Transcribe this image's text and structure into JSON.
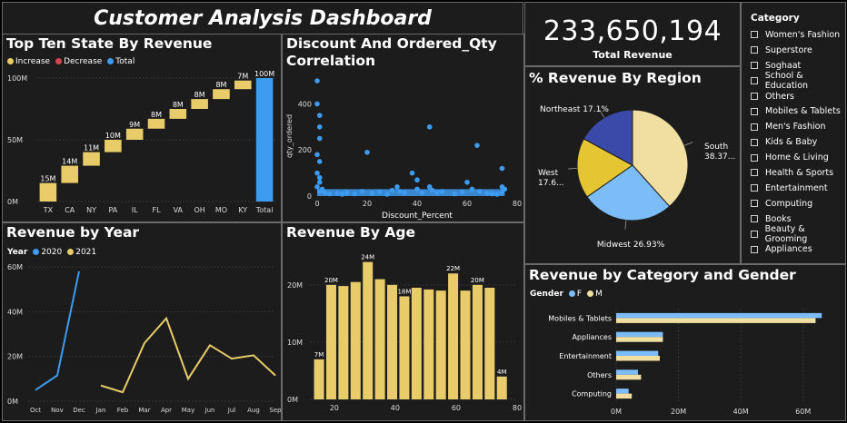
{
  "dashboard": {
    "title": "Customer Analysis Dashboard"
  },
  "colors": {
    "yellow": "#e8cc6a",
    "blue": "#3d9bf0",
    "navy": "#3b4aa8",
    "light_blue": "#7cbcf7",
    "sand": "#f0dfa0",
    "gold": "#e5c532",
    "decrease_red": "#d0494f"
  },
  "kpi": {
    "value": "233,650,194",
    "label": "Total Revenue"
  },
  "top_states": {
    "title": "Top Ten State By Revenue",
    "legend": [
      {
        "label": "Increase",
        "color": "#e8cc6a"
      },
      {
        "label": "Decrease",
        "color": "#d0494f"
      },
      {
        "label": "Total",
        "color": "#3d9bf0"
      }
    ],
    "y_ticks": [
      "100M",
      "50M",
      "0M"
    ],
    "chart_data": {
      "type": "bar",
      "subtype": "waterfall",
      "categories": [
        "TX",
        "CA",
        "NY",
        "PA",
        "IL",
        "FL",
        "VA",
        "OH",
        "MO",
        "KY",
        "Total"
      ],
      "values": [
        15,
        14,
        11,
        10,
        9,
        8,
        8,
        8,
        8,
        7,
        100
      ],
      "labels": [
        "15M",
        "14M",
        "11M",
        "10M",
        "9M",
        "8M",
        "8M",
        "8M",
        "8M",
        "7M",
        "100M"
      ],
      "ylim": [
        0,
        100
      ]
    }
  },
  "discount": {
    "title": "Discount And Ordered_Qty\nCorrelation",
    "xlabel": "Discount_Percent",
    "ylabel": "qty_ordered",
    "y_ticks": [
      "400",
      "200",
      "0"
    ],
    "x_ticks": [
      "0",
      "20",
      "40",
      "60",
      "80"
    ],
    "chart_data": {
      "type": "scatter",
      "xlim": [
        0,
        80
      ],
      "ylim": [
        0,
        520
      ],
      "points": [
        [
          0,
          500
        ],
        [
          0,
          400
        ],
        [
          1,
          350
        ],
        [
          1,
          300
        ],
        [
          1,
          250
        ],
        [
          0,
          180
        ],
        [
          1,
          150
        ],
        [
          0,
          100
        ],
        [
          1,
          80
        ],
        [
          1,
          60
        ],
        [
          0,
          40
        ],
        [
          2,
          30
        ],
        [
          1,
          20
        ],
        [
          3,
          15
        ],
        [
          5,
          10
        ],
        [
          8,
          12
        ],
        [
          10,
          8
        ],
        [
          12,
          15
        ],
        [
          15,
          10
        ],
        [
          18,
          20
        ],
        [
          20,
          190
        ],
        [
          22,
          12
        ],
        [
          25,
          18
        ],
        [
          28,
          8
        ],
        [
          30,
          25
        ],
        [
          32,
          40
        ],
        [
          33,
          20
        ],
        [
          35,
          15
        ],
        [
          38,
          100
        ],
        [
          40,
          70
        ],
        [
          40,
          30
        ],
        [
          42,
          15
        ],
        [
          45,
          300
        ],
        [
          45,
          40
        ],
        [
          46,
          25
        ],
        [
          48,
          15
        ],
        [
          50,
          20
        ],
        [
          55,
          10
        ],
        [
          58,
          18
        ],
        [
          60,
          60
        ],
        [
          62,
          30
        ],
        [
          64,
          220
        ],
        [
          65,
          20
        ],
        [
          68,
          12
        ],
        [
          70,
          10
        ],
        [
          72,
          8
        ],
        [
          74,
          120
        ],
        [
          74,
          40
        ],
        [
          74,
          15
        ],
        [
          75,
          30
        ]
      ]
    }
  },
  "region": {
    "title": "% Revenue By Region",
    "chart_data": {
      "type": "pie",
      "slices": [
        {
          "name": "South",
          "value": 38.37,
          "label": "South\n38.37...",
          "color": "#f0dfa0"
        },
        {
          "name": "Midwest",
          "value": 26.93,
          "label": "Midwest 26.93%",
          "color": "#7cbcf7"
        },
        {
          "name": "West",
          "value": 17.6,
          "label": "West\n17.6...",
          "color": "#e5c532"
        },
        {
          "name": "Northeast",
          "value": 17.1,
          "label": "Northeast 17.1%",
          "color": "#3b4aa8"
        }
      ]
    }
  },
  "category": {
    "title": "Category",
    "items": [
      "Women's Fashion",
      "Superstore",
      "Soghaat",
      "School & Education",
      "Others",
      "Mobiles & Tablets",
      "Men's Fashion",
      "Kids & Baby",
      "Home & Living",
      "Health & Sports",
      "Entertainment",
      "Computing",
      "Books",
      "Beauty & Grooming",
      "Appliances"
    ]
  },
  "year": {
    "title": "Revenue by Year",
    "legend_title": "Year",
    "legend": [
      {
        "label": "2020",
        "color": "#3d9bf0"
      },
      {
        "label": "2021",
        "color": "#e8cc6a"
      }
    ],
    "y_ticks": [
      "60M",
      "40M",
      "20M",
      "0M"
    ],
    "chart_data": {
      "type": "line",
      "x": [
        "Oct",
        "Nov",
        "Dec",
        "Jan",
        "Feb",
        "Mar",
        "Apr",
        "May",
        "Jun",
        "Jul",
        "Aug",
        "Sep"
      ],
      "ylim": [
        0,
        60
      ],
      "series": [
        {
          "name": "2020",
          "x": [
            "Oct",
            "Nov",
            "Dec"
          ],
          "values": [
            5,
            11.5,
            58
          ]
        },
        {
          "name": "2021",
          "x": [
            "Jan",
            "Feb",
            "Mar",
            "Apr",
            "May",
            "Jun",
            "Jul",
            "Aug",
            "Sep"
          ],
          "values": [
            7,
            4,
            26,
            37,
            10,
            25,
            19,
            20.5,
            11.5
          ]
        }
      ]
    }
  },
  "age": {
    "title": "Revenue By Age",
    "y_ticks": [
      "20M",
      "10M",
      "0M"
    ],
    "x_ticks": [
      "20",
      "40",
      "60",
      "80"
    ],
    "chart_data": {
      "type": "bar",
      "x": [
        15,
        19,
        23,
        27,
        31,
        35,
        39,
        43,
        47,
        51,
        55,
        59,
        63,
        67,
        71,
        75
      ],
      "values": [
        7,
        20,
        19.8,
        20.5,
        24,
        21,
        20,
        18,
        19.5,
        19.2,
        19,
        22,
        19,
        20,
        19.5,
        4
      ],
      "labels": [
        "7M",
        "20M",
        "",
        "",
        "24M",
        "",
        "",
        "18M",
        "",
        "",
        "",
        "22M",
        "",
        "20M",
        "",
        "4M"
      ],
      "xlim": [
        12,
        80
      ],
      "ylim": [
        0,
        26
      ]
    }
  },
  "gender": {
    "title": "Revenue by Category and Gender",
    "legend_title": "Gender",
    "legend": [
      {
        "label": "F",
        "color": "#7cbcf7"
      },
      {
        "label": "M",
        "color": "#f0dfa0"
      }
    ],
    "x_ticks": [
      "0M",
      "20M",
      "40M",
      "60M"
    ],
    "chart_data": {
      "type": "bar",
      "orientation": "horizontal",
      "categories": [
        "Mobiles & Tablets",
        "Appliances",
        "Entertainment",
        "Others",
        "Computing"
      ],
      "xlim": [
        0,
        70
      ],
      "series": [
        {
          "name": "F",
          "values": [
            66,
            15,
            13.5,
            7,
            4
          ]
        },
        {
          "name": "M",
          "values": [
            64,
            15,
            14,
            8,
            5
          ]
        }
      ]
    }
  }
}
